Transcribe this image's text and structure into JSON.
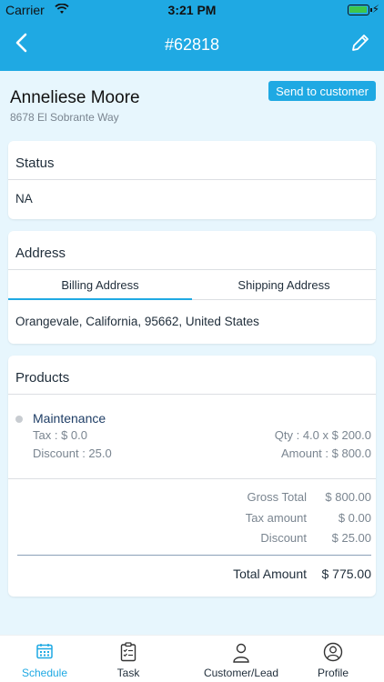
{
  "status_bar": {
    "carrier": "Carrier",
    "time": "3:21 PM"
  },
  "nav": {
    "title": "#62818"
  },
  "customer": {
    "name": "Anneliese Moore",
    "address": "8678 El Sobrante Way",
    "send_label": "Send to customer"
  },
  "status_card": {
    "title": "Status",
    "value": "NA"
  },
  "address_card": {
    "title": "Address",
    "tabs": [
      "Billing Address",
      "Shipping Address"
    ],
    "active_tab": "Billing Address",
    "value": "Orangevale, California, 95662, United States"
  },
  "products_card": {
    "title": "Products",
    "items": [
      {
        "name": "Maintenance",
        "tax": "Tax : $ 0.0",
        "qty": "Qty : 4.0 x $ 200.0",
        "discount": "Discount : 25.0",
        "amount": "Amount : $ 800.0"
      }
    ],
    "totals": [
      {
        "label": "Gross Total",
        "value": "$ 800.00"
      },
      {
        "label": "Tax amount",
        "value": "$ 0.00"
      },
      {
        "label": "Discount",
        "value": "$ 25.00"
      }
    ],
    "grand_total_label": "Total Amount",
    "grand_total_value": "$ 775.00"
  },
  "bottom_nav": {
    "items": [
      {
        "label": "Schedule",
        "icon": "calendar-icon",
        "active": true
      },
      {
        "label": "Task",
        "icon": "clipboard-icon",
        "active": false
      },
      {
        "label": "Customer/Lead",
        "icon": "person-icon",
        "active": false
      },
      {
        "label": "Profile",
        "icon": "profile-icon",
        "active": false
      }
    ]
  },
  "colors": {
    "accent": "#1fa9e3",
    "background": "#e7f6fd",
    "text": "#1f2d3a",
    "muted": "#7a8590"
  }
}
